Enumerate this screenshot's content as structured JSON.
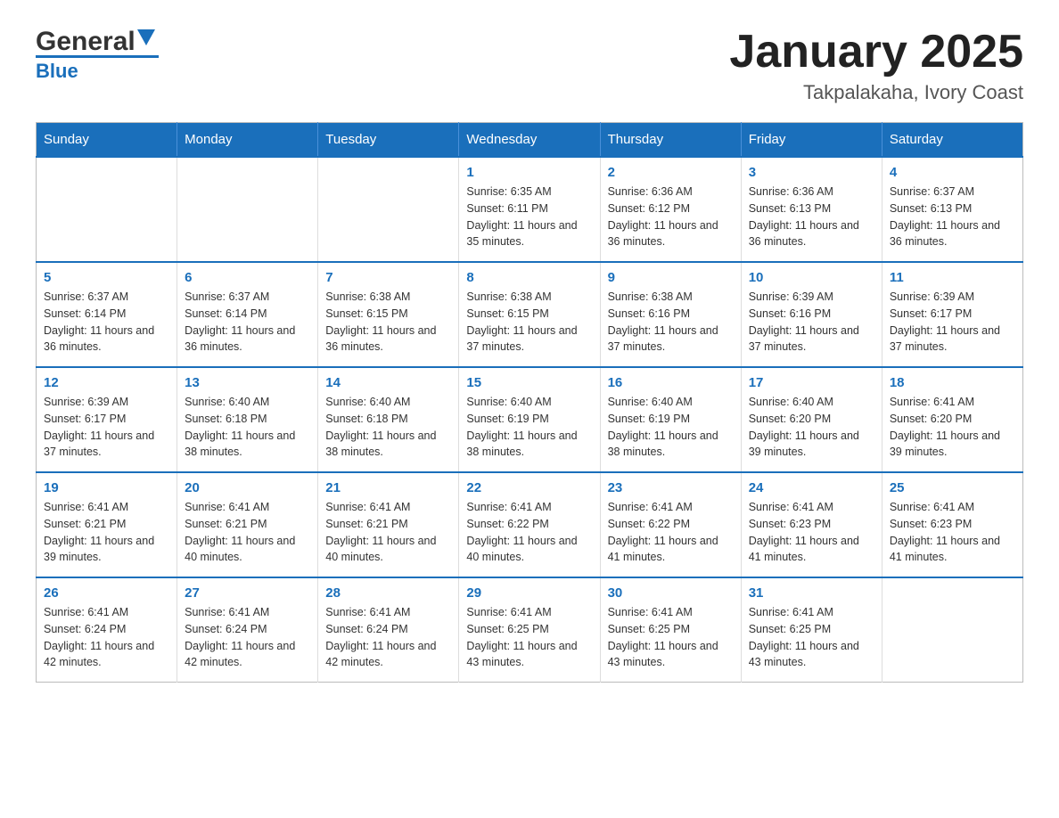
{
  "header": {
    "logo_general": "General",
    "logo_blue": "Blue",
    "month_title": "January 2025",
    "location": "Takpalakaha, Ivory Coast"
  },
  "days_of_week": [
    "Sunday",
    "Monday",
    "Tuesday",
    "Wednesday",
    "Thursday",
    "Friday",
    "Saturday"
  ],
  "weeks": [
    [
      {
        "day": "",
        "sunrise": "",
        "sunset": "",
        "daylight": ""
      },
      {
        "day": "",
        "sunrise": "",
        "sunset": "",
        "daylight": ""
      },
      {
        "day": "",
        "sunrise": "",
        "sunset": "",
        "daylight": ""
      },
      {
        "day": "1",
        "sunrise": "Sunrise: 6:35 AM",
        "sunset": "Sunset: 6:11 PM",
        "daylight": "Daylight: 11 hours and 35 minutes."
      },
      {
        "day": "2",
        "sunrise": "Sunrise: 6:36 AM",
        "sunset": "Sunset: 6:12 PM",
        "daylight": "Daylight: 11 hours and 36 minutes."
      },
      {
        "day": "3",
        "sunrise": "Sunrise: 6:36 AM",
        "sunset": "Sunset: 6:13 PM",
        "daylight": "Daylight: 11 hours and 36 minutes."
      },
      {
        "day": "4",
        "sunrise": "Sunrise: 6:37 AM",
        "sunset": "Sunset: 6:13 PM",
        "daylight": "Daylight: 11 hours and 36 minutes."
      }
    ],
    [
      {
        "day": "5",
        "sunrise": "Sunrise: 6:37 AM",
        "sunset": "Sunset: 6:14 PM",
        "daylight": "Daylight: 11 hours and 36 minutes."
      },
      {
        "day": "6",
        "sunrise": "Sunrise: 6:37 AM",
        "sunset": "Sunset: 6:14 PM",
        "daylight": "Daylight: 11 hours and 36 minutes."
      },
      {
        "day": "7",
        "sunrise": "Sunrise: 6:38 AM",
        "sunset": "Sunset: 6:15 PM",
        "daylight": "Daylight: 11 hours and 36 minutes."
      },
      {
        "day": "8",
        "sunrise": "Sunrise: 6:38 AM",
        "sunset": "Sunset: 6:15 PM",
        "daylight": "Daylight: 11 hours and 37 minutes."
      },
      {
        "day": "9",
        "sunrise": "Sunrise: 6:38 AM",
        "sunset": "Sunset: 6:16 PM",
        "daylight": "Daylight: 11 hours and 37 minutes."
      },
      {
        "day": "10",
        "sunrise": "Sunrise: 6:39 AM",
        "sunset": "Sunset: 6:16 PM",
        "daylight": "Daylight: 11 hours and 37 minutes."
      },
      {
        "day": "11",
        "sunrise": "Sunrise: 6:39 AM",
        "sunset": "Sunset: 6:17 PM",
        "daylight": "Daylight: 11 hours and 37 minutes."
      }
    ],
    [
      {
        "day": "12",
        "sunrise": "Sunrise: 6:39 AM",
        "sunset": "Sunset: 6:17 PM",
        "daylight": "Daylight: 11 hours and 37 minutes."
      },
      {
        "day": "13",
        "sunrise": "Sunrise: 6:40 AM",
        "sunset": "Sunset: 6:18 PM",
        "daylight": "Daylight: 11 hours and 38 minutes."
      },
      {
        "day": "14",
        "sunrise": "Sunrise: 6:40 AM",
        "sunset": "Sunset: 6:18 PM",
        "daylight": "Daylight: 11 hours and 38 minutes."
      },
      {
        "day": "15",
        "sunrise": "Sunrise: 6:40 AM",
        "sunset": "Sunset: 6:19 PM",
        "daylight": "Daylight: 11 hours and 38 minutes."
      },
      {
        "day": "16",
        "sunrise": "Sunrise: 6:40 AM",
        "sunset": "Sunset: 6:19 PM",
        "daylight": "Daylight: 11 hours and 38 minutes."
      },
      {
        "day": "17",
        "sunrise": "Sunrise: 6:40 AM",
        "sunset": "Sunset: 6:20 PM",
        "daylight": "Daylight: 11 hours and 39 minutes."
      },
      {
        "day": "18",
        "sunrise": "Sunrise: 6:41 AM",
        "sunset": "Sunset: 6:20 PM",
        "daylight": "Daylight: 11 hours and 39 minutes."
      }
    ],
    [
      {
        "day": "19",
        "sunrise": "Sunrise: 6:41 AM",
        "sunset": "Sunset: 6:21 PM",
        "daylight": "Daylight: 11 hours and 39 minutes."
      },
      {
        "day": "20",
        "sunrise": "Sunrise: 6:41 AM",
        "sunset": "Sunset: 6:21 PM",
        "daylight": "Daylight: 11 hours and 40 minutes."
      },
      {
        "day": "21",
        "sunrise": "Sunrise: 6:41 AM",
        "sunset": "Sunset: 6:21 PM",
        "daylight": "Daylight: 11 hours and 40 minutes."
      },
      {
        "day": "22",
        "sunrise": "Sunrise: 6:41 AM",
        "sunset": "Sunset: 6:22 PM",
        "daylight": "Daylight: 11 hours and 40 minutes."
      },
      {
        "day": "23",
        "sunrise": "Sunrise: 6:41 AM",
        "sunset": "Sunset: 6:22 PM",
        "daylight": "Daylight: 11 hours and 41 minutes."
      },
      {
        "day": "24",
        "sunrise": "Sunrise: 6:41 AM",
        "sunset": "Sunset: 6:23 PM",
        "daylight": "Daylight: 11 hours and 41 minutes."
      },
      {
        "day": "25",
        "sunrise": "Sunrise: 6:41 AM",
        "sunset": "Sunset: 6:23 PM",
        "daylight": "Daylight: 11 hours and 41 minutes."
      }
    ],
    [
      {
        "day": "26",
        "sunrise": "Sunrise: 6:41 AM",
        "sunset": "Sunset: 6:24 PM",
        "daylight": "Daylight: 11 hours and 42 minutes."
      },
      {
        "day": "27",
        "sunrise": "Sunrise: 6:41 AM",
        "sunset": "Sunset: 6:24 PM",
        "daylight": "Daylight: 11 hours and 42 minutes."
      },
      {
        "day": "28",
        "sunrise": "Sunrise: 6:41 AM",
        "sunset": "Sunset: 6:24 PM",
        "daylight": "Daylight: 11 hours and 42 minutes."
      },
      {
        "day": "29",
        "sunrise": "Sunrise: 6:41 AM",
        "sunset": "Sunset: 6:25 PM",
        "daylight": "Daylight: 11 hours and 43 minutes."
      },
      {
        "day": "30",
        "sunrise": "Sunrise: 6:41 AM",
        "sunset": "Sunset: 6:25 PM",
        "daylight": "Daylight: 11 hours and 43 minutes."
      },
      {
        "day": "31",
        "sunrise": "Sunrise: 6:41 AM",
        "sunset": "Sunset: 6:25 PM",
        "daylight": "Daylight: 11 hours and 43 minutes."
      },
      {
        "day": "",
        "sunrise": "",
        "sunset": "",
        "daylight": ""
      }
    ]
  ]
}
